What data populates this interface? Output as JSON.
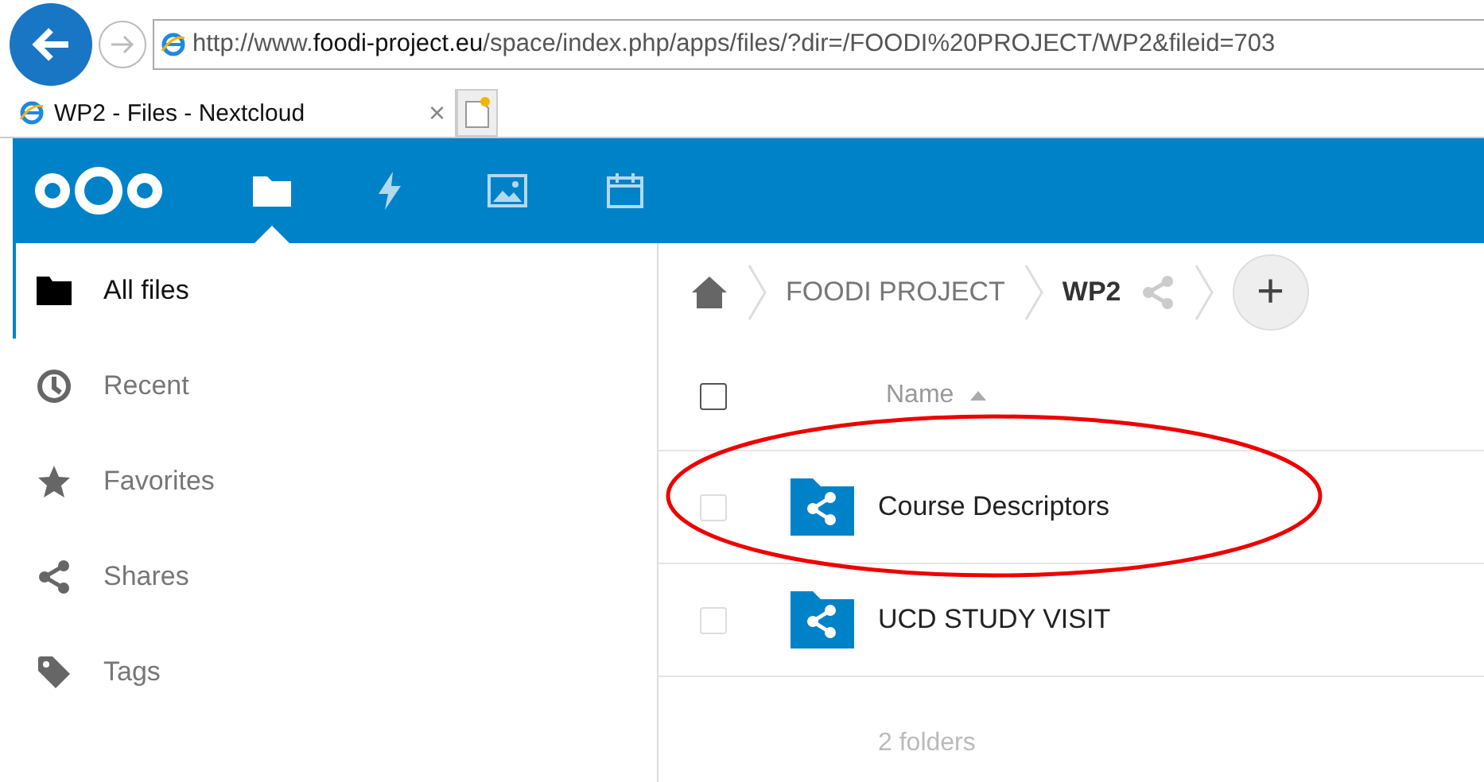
{
  "browser": {
    "url": "http://www.**foodi-project.eu**/space/index.php/apps/files/?dir=/FOODI%20PROJECT/WP2&fileid=703",
    "tab": {
      "title": "WP2 - Files - Nextcloud",
      "close": "×"
    }
  },
  "header": {
    "apps": [
      {
        "kind": "files",
        "selected": true
      },
      {
        "kind": "activity",
        "selected": false
      },
      {
        "kind": "gallery",
        "selected": false
      },
      {
        "kind": "calendar",
        "selected": false
      }
    ]
  },
  "sidebar": {
    "items": [
      {
        "kind": "folder",
        "label": "All files",
        "selected": true
      },
      {
        "kind": "clock",
        "label": "Recent",
        "selected": false
      },
      {
        "kind": "star",
        "label": "Favorites",
        "selected": false
      },
      {
        "kind": "share",
        "label": "Shares",
        "selected": false
      },
      {
        "kind": "tag",
        "label": "Tags",
        "selected": false
      }
    ]
  },
  "breadcrumb": {
    "items": [
      "FOODI PROJECT",
      "WP2"
    ],
    "add_button": "+"
  },
  "table": {
    "select_all": {
      "checked": false
    },
    "columns": [
      {
        "label": "Name",
        "sorted": true
      }
    ],
    "rows": [
      {
        "name": "Course Descriptors",
        "checked": false,
        "circled": true
      },
      {
        "name": "UCD STUDY VISIT",
        "checked": false,
        "circled": false
      }
    ],
    "summary": "2 folders"
  }
}
